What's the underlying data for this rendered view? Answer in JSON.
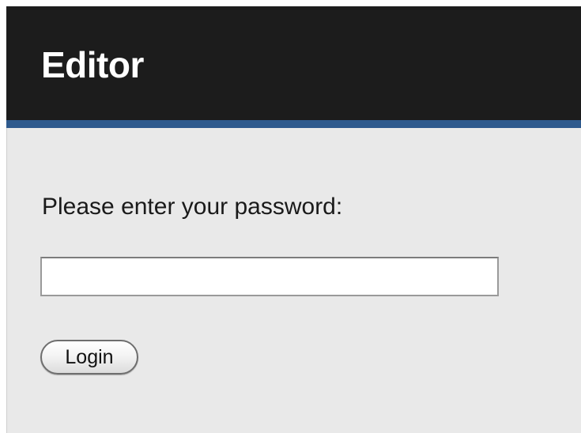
{
  "header": {
    "title": "Editor"
  },
  "form": {
    "prompt": "Please enter your password:",
    "password": {
      "value": "",
      "placeholder": ""
    },
    "login_label": "Login"
  },
  "colors": {
    "header_bg": "#1c1c1c",
    "accent": "#2f5a8d",
    "content_bg": "#e9e9e9"
  }
}
